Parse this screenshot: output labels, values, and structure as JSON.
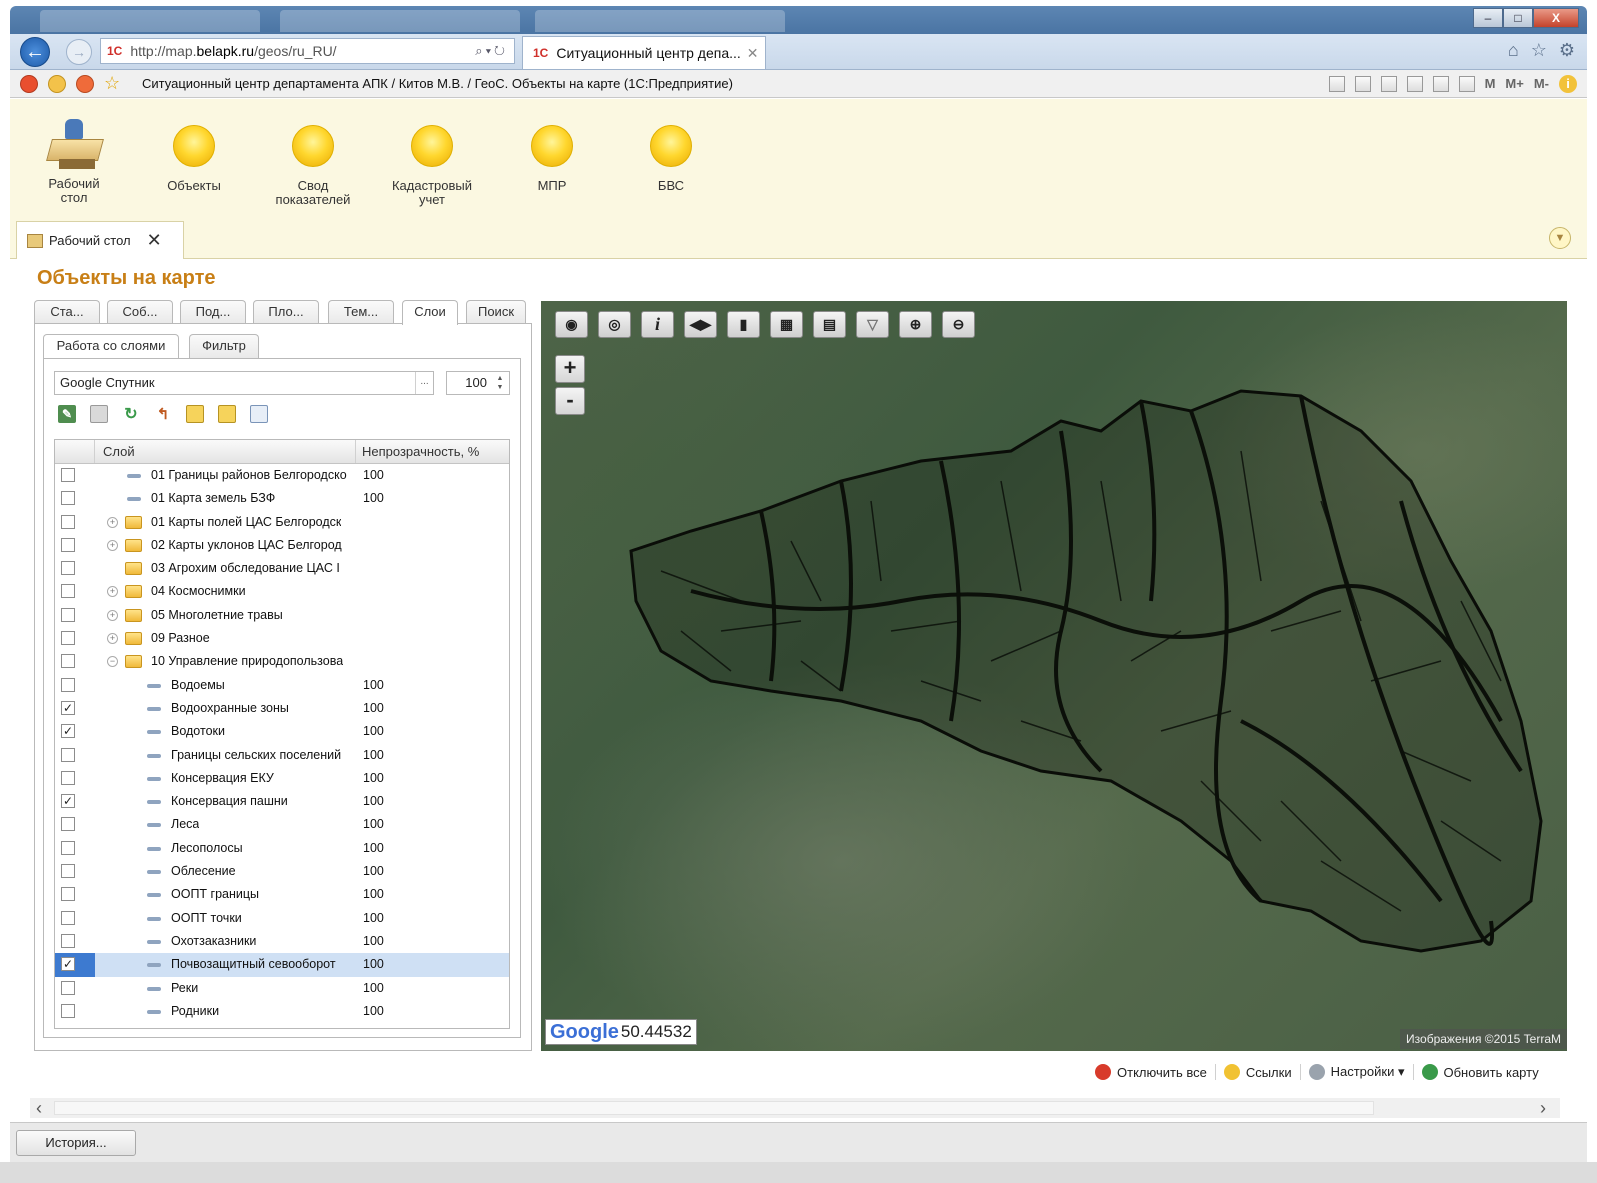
{
  "browser": {
    "url_prefix": "http://map.",
    "url_domain": "belapk.ru",
    "url_suffix": "/geos/ru_RU/",
    "tab_title": "Ситуационный центр депа...",
    "window_buttons": [
      "–",
      "□",
      "X"
    ]
  },
  "app_header": {
    "title": "Ситуационный центр департамента АПК / Китов М.В. / ГеоС. Объекты на карте  (1С:Предприятие)",
    "memory_buttons": [
      "M",
      "M+",
      "M-"
    ]
  },
  "sections": [
    {
      "label": "Рабочий стол",
      "icon": "desk-icon"
    },
    {
      "label": "Объекты",
      "icon": "orb-icon"
    },
    {
      "label": "Свод показателей",
      "icon": "orb-icon"
    },
    {
      "label": "Кадастровый учет",
      "icon": "orb-icon"
    },
    {
      "label": "МПР",
      "icon": "orb-icon"
    },
    {
      "label": "БВС",
      "icon": "orb-icon"
    }
  ],
  "open_tab": {
    "label": "Рабочий стол"
  },
  "page": {
    "title": "Объекты на карте"
  },
  "main_tabs": [
    "Ста...",
    "Соб...",
    "Под...",
    "Пло...",
    "Тем...",
    "Слои",
    "Поиск"
  ],
  "active_main_tab": "Слои",
  "sub_tabs": [
    "Работа со слоями",
    "Фильтр"
  ],
  "base_layer": {
    "value": "Google Спутник",
    "opacity": "100"
  },
  "layers_table": {
    "col_layer": "Слой",
    "col_opacity": "Непрозрачность, %",
    "rows": [
      {
        "name": "01 Границы районов Белгородско",
        "value": "100",
        "checked": false,
        "level": 0,
        "type": "layer",
        "expander": "",
        "selected": false
      },
      {
        "name": "01 Карта земель БЗФ",
        "value": "100",
        "checked": false,
        "level": 0,
        "type": "layer",
        "expander": "",
        "selected": false
      },
      {
        "name": "01 Карты полей ЦАС Белгородск",
        "value": "",
        "checked": false,
        "level": 0,
        "type": "folder",
        "expander": "+",
        "selected": false
      },
      {
        "name": "02 Карты уклонов ЦАС Белгород",
        "value": "",
        "checked": false,
        "level": 0,
        "type": "folder",
        "expander": "+",
        "selected": false
      },
      {
        "name": "03 Агрохим обследование ЦАС I",
        "value": "",
        "checked": false,
        "level": 0,
        "type": "folder",
        "expander": "",
        "selected": false
      },
      {
        "name": "04 Космоснимки",
        "value": "",
        "checked": false,
        "level": 0,
        "type": "folder",
        "expander": "+",
        "selected": false
      },
      {
        "name": "05 Многолетние травы",
        "value": "",
        "checked": false,
        "level": 0,
        "type": "folder",
        "expander": "+",
        "selected": false
      },
      {
        "name": "09 Разное",
        "value": "",
        "checked": false,
        "level": 0,
        "type": "folder",
        "expander": "+",
        "selected": false
      },
      {
        "name": "10 Управление природопользова",
        "value": "",
        "checked": false,
        "level": 0,
        "type": "folder",
        "expander": "−",
        "selected": false
      },
      {
        "name": "Водоемы",
        "value": "100",
        "checked": false,
        "level": 1,
        "type": "layer",
        "expander": "",
        "selected": false
      },
      {
        "name": "Водоохранные зоны",
        "value": "100",
        "checked": true,
        "level": 1,
        "type": "layer",
        "expander": "",
        "selected": false
      },
      {
        "name": "Водотоки",
        "value": "100",
        "checked": true,
        "level": 1,
        "type": "layer",
        "expander": "",
        "selected": false
      },
      {
        "name": "Границы сельских поселений",
        "value": "100",
        "checked": false,
        "level": 1,
        "type": "layer",
        "expander": "",
        "selected": false
      },
      {
        "name": "Консервация ЕКУ",
        "value": "100",
        "checked": false,
        "level": 1,
        "type": "layer",
        "expander": "",
        "selected": false
      },
      {
        "name": "Консервация пашни",
        "value": "100",
        "checked": true,
        "level": 1,
        "type": "layer",
        "expander": "",
        "selected": false
      },
      {
        "name": "Леса",
        "value": "100",
        "checked": false,
        "level": 1,
        "type": "layer",
        "expander": "",
        "selected": false
      },
      {
        "name": "Лесополосы",
        "value": "100",
        "checked": false,
        "level": 1,
        "type": "layer",
        "expander": "",
        "selected": false
      },
      {
        "name": "Облесение",
        "value": "100",
        "checked": false,
        "level": 1,
        "type": "layer",
        "expander": "",
        "selected": false
      },
      {
        "name": "ООПТ границы",
        "value": "100",
        "checked": false,
        "level": 1,
        "type": "layer",
        "expander": "",
        "selected": false
      },
      {
        "name": "ООПТ точки",
        "value": "100",
        "checked": false,
        "level": 1,
        "type": "layer",
        "expander": "",
        "selected": false
      },
      {
        "name": "Охотзаказники",
        "value": "100",
        "checked": false,
        "level": 1,
        "type": "layer",
        "expander": "",
        "selected": false
      },
      {
        "name": "Почвозащитный севооборот",
        "value": "100",
        "checked": true,
        "level": 1,
        "type": "layer",
        "expander": "",
        "selected": true
      },
      {
        "name": "Реки",
        "value": "100",
        "checked": false,
        "level": 1,
        "type": "layer",
        "expander": "",
        "selected": false
      },
      {
        "name": "Родники",
        "value": "100",
        "checked": false,
        "level": 1,
        "type": "layer",
        "expander": "",
        "selected": false
      }
    ]
  },
  "map": {
    "zoom_in": "+",
    "zoom_out": "-",
    "google_label": "Google",
    "coordinate": "50.44532",
    "copyright": "Изображения ©2015 TerraM"
  },
  "map_actions": [
    {
      "label": "Отключить все",
      "color": "#d83b2b"
    },
    {
      "label": "Ссылки",
      "color": "#f1c232"
    },
    {
      "label": "Настройки ▾",
      "color": "#9aa3ad"
    },
    {
      "label": "Обновить карту",
      "color": "#3a9a4a"
    }
  ],
  "status": {
    "history_button": "История..."
  }
}
